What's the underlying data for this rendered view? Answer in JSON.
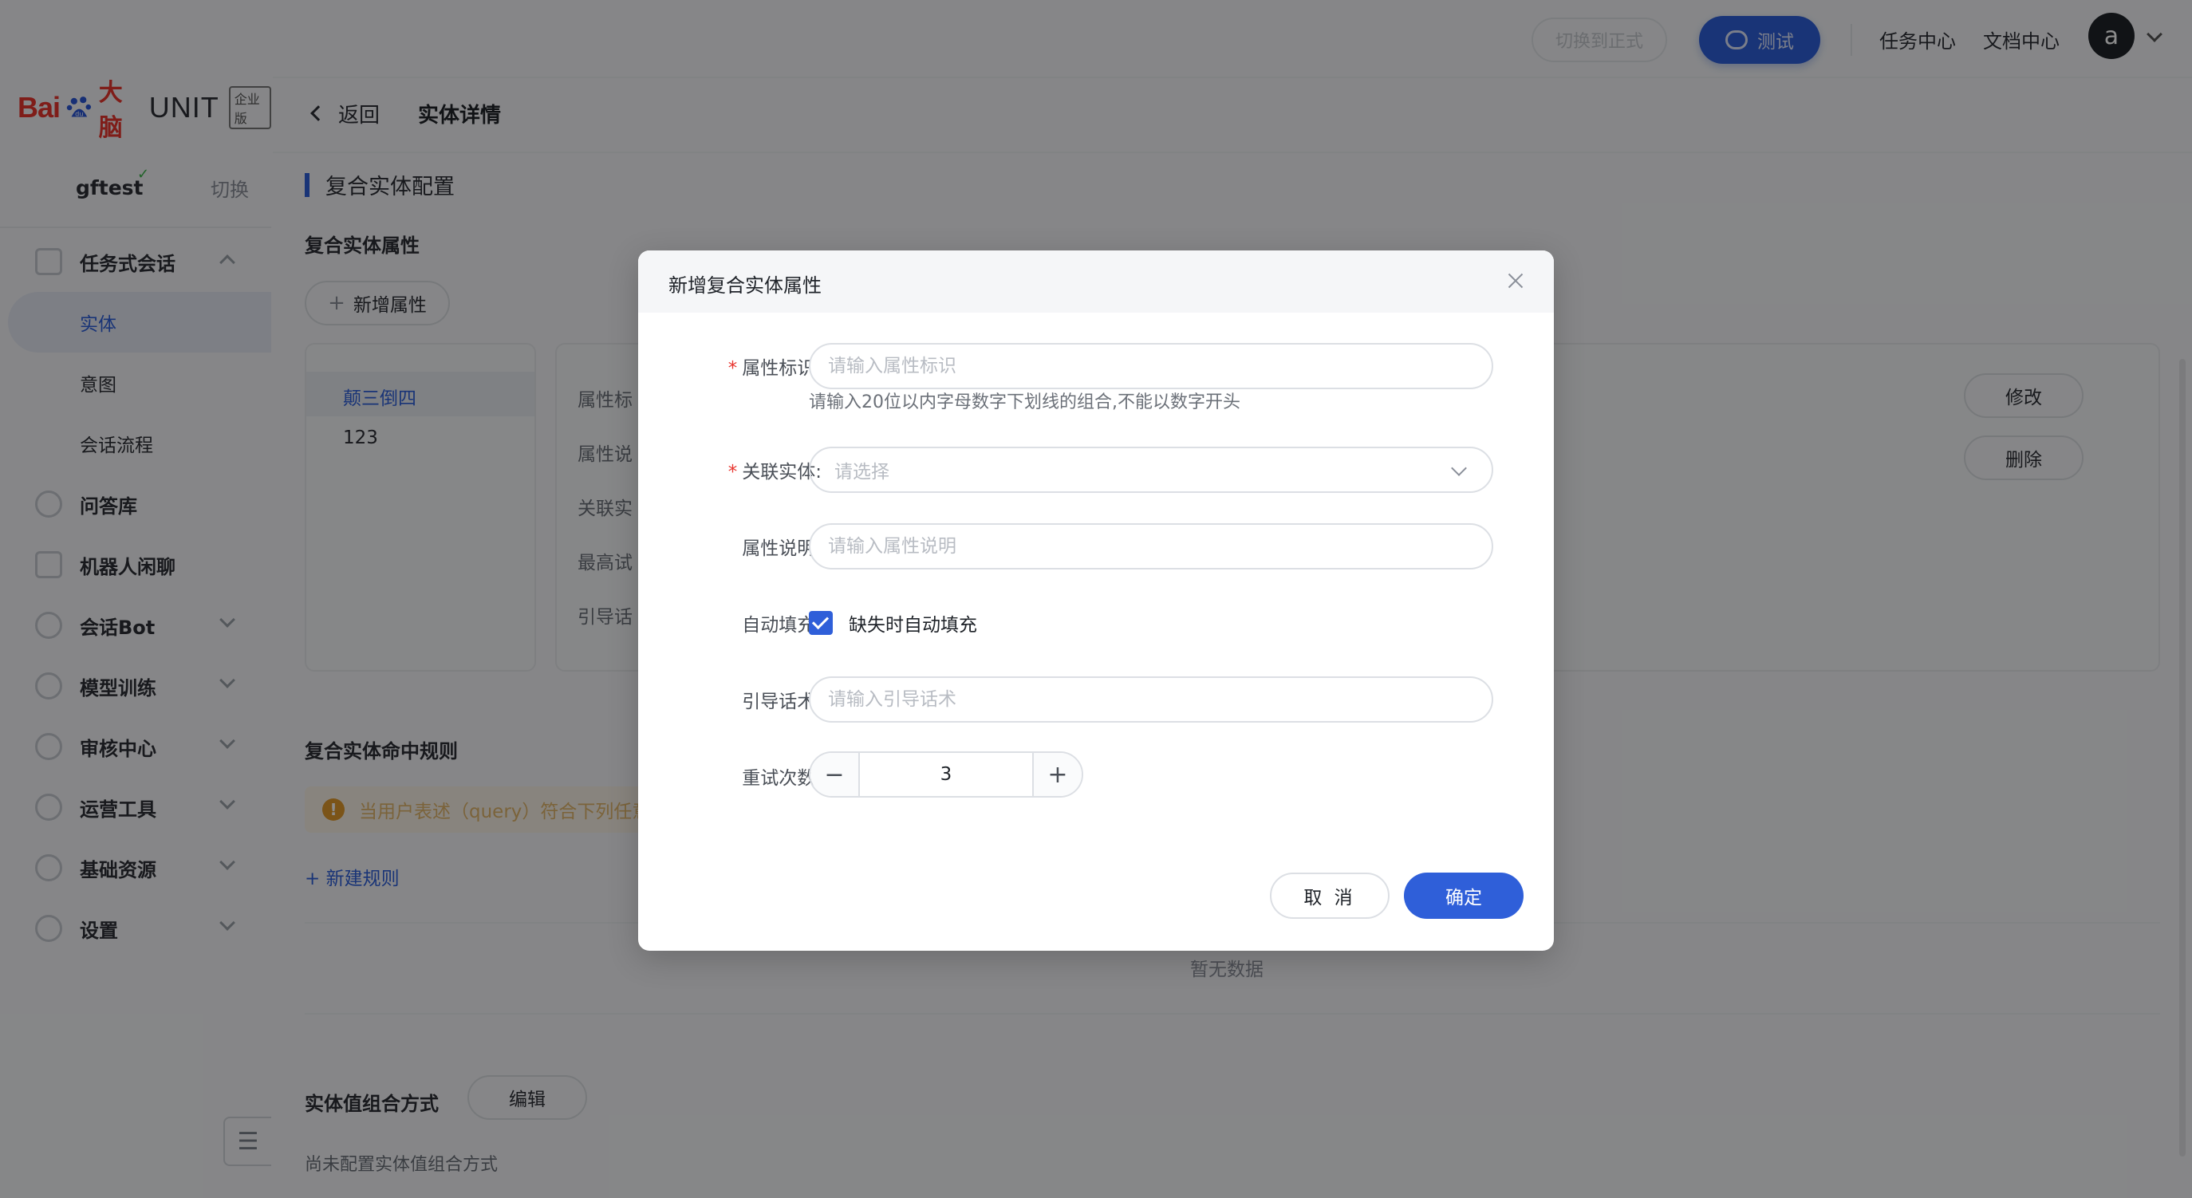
{
  "brand": {
    "bai": "Bai",
    "du": "du",
    "dn": "大脑",
    "unit": "UNIT",
    "badge": "企业版"
  },
  "user": {
    "name": "gftest",
    "switch": "切换"
  },
  "sidebar": {
    "items": [
      {
        "label": "任务式会话",
        "expanded": true
      },
      {
        "label": "实体",
        "sub": true,
        "active": true
      },
      {
        "label": "意图",
        "sub": true
      },
      {
        "label": "会话流程",
        "sub": true
      },
      {
        "label": "问答库"
      },
      {
        "label": "机器人闲聊"
      },
      {
        "label": "会话Bot"
      },
      {
        "label": "模型训练"
      },
      {
        "label": "审核中心"
      },
      {
        "label": "运营工具"
      },
      {
        "label": "基础资源"
      },
      {
        "label": "设置"
      }
    ]
  },
  "topbar": {
    "switch_formal": "切换到正式",
    "test": "测试",
    "task_center": "任务中心",
    "docs_center": "文档中心",
    "avatar": "a"
  },
  "breadcrumb": {
    "back": "返回",
    "title": "实体详情"
  },
  "main": {
    "section_title": "复合实体配置",
    "attr_title": "复合实体属性",
    "add_attr": "新增属性",
    "list": [
      "颠三倒四",
      "123"
    ],
    "attr_labels": [
      "属性标",
      "属性说",
      "关联实",
      "最高试",
      "引导话"
    ],
    "edit": "修改",
    "delete": "删除",
    "rule_title": "复合实体命中规则",
    "warning": "当用户表述（query）符合下列任意",
    "new_rule": "新建规则",
    "empty": "暂无数据",
    "combo_title": "实体值组合方式",
    "combo_edit": "编辑",
    "combo_empty": "尚未配置实体值组合方式"
  },
  "dialog": {
    "title": "新增复合实体属性",
    "fields": {
      "attr_id": {
        "label": "属性标识:",
        "placeholder": "请输入属性标识",
        "hint": "请输入20位以内字母数字下划线的组合,不能以数字开头"
      },
      "entity": {
        "label": "关联实体:",
        "placeholder": "请选择"
      },
      "desc": {
        "label": "属性说明:",
        "placeholder": "请输入属性说明"
      },
      "autofill": {
        "label": "自动填充:",
        "checkbox_label": "缺失时自动填充",
        "checked": true
      },
      "guide": {
        "label": "引导话术:",
        "placeholder": "请输入引导话术"
      },
      "retry": {
        "label": "重试次数:",
        "value": "3"
      }
    },
    "cancel": "取 消",
    "confirm": "确定"
  },
  "colors": {
    "primary": "#2f5fd9",
    "required": "#e8352e",
    "warning": "#e09a2c"
  }
}
